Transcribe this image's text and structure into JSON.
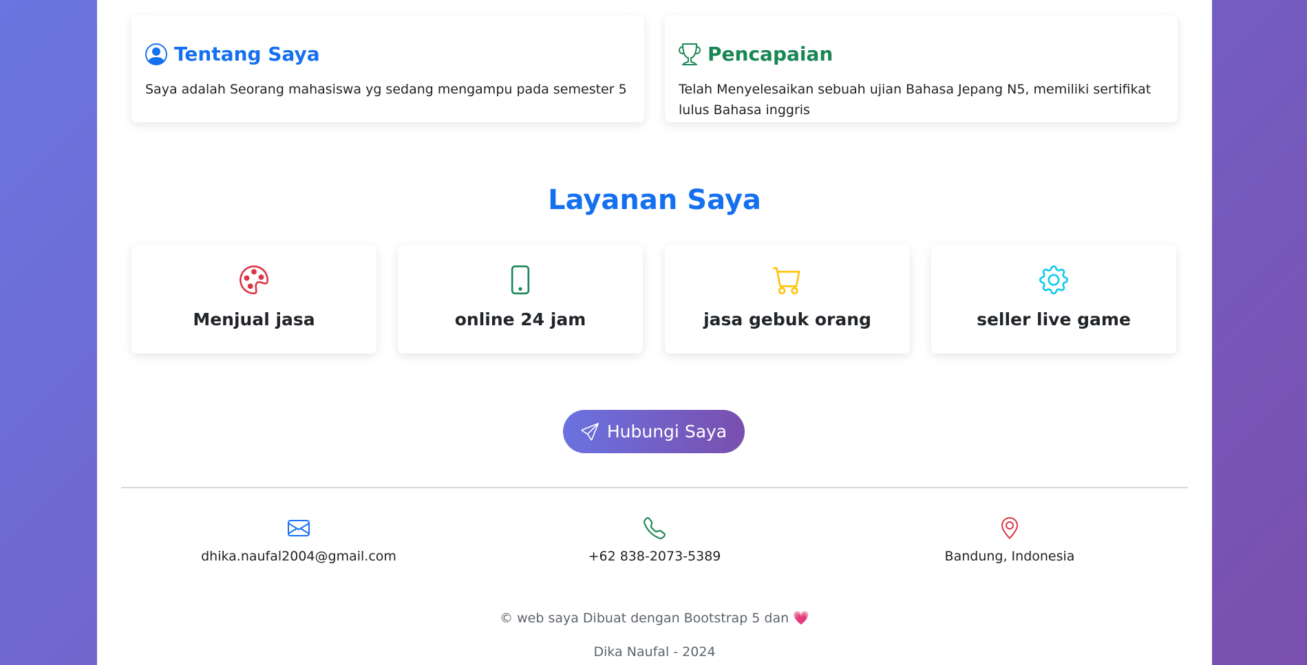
{
  "about": {
    "title": "Tentang Saya",
    "text": "Saya adalah Seorang mahasiswa yg sedang mengampu pada semester 5",
    "icon": "person-circle-icon",
    "color": "#1570ef"
  },
  "achievement": {
    "title": "Pencapaian",
    "text": "Telah Menyelesaikan sebuah ujian Bahasa Jepang N5, memiliki sertifikat lulus Bahasa inggris",
    "icon": "trophy-icon",
    "color": "#198754"
  },
  "services": {
    "title": "Layanan Saya",
    "items": [
      {
        "label": "Menjual jasa",
        "icon": "palette-icon",
        "color": "#dc3545"
      },
      {
        "label": "online 24 jam",
        "icon": "phone-icon",
        "color": "#198754"
      },
      {
        "label": "jasa gebuk orang",
        "icon": "cart-icon",
        "color": "#ffc107"
      },
      {
        "label": "seller live game",
        "icon": "gear-icon",
        "color": "#0dcaf0"
      }
    ]
  },
  "cta": {
    "label": "Hubungi Saya",
    "icon": "send-icon"
  },
  "contacts": [
    {
      "text": "dhika.naufal2004@gmail.com",
      "icon": "envelope-icon",
      "color": "#1570ef"
    },
    {
      "text": "+62 838-2073-5389",
      "icon": "telephone-icon",
      "color": "#198754"
    },
    {
      "text": "Bandung, Indonesia",
      "icon": "geo-pin-icon",
      "color": "#dc3545"
    }
  ],
  "footer": {
    "copyright": "© web saya Dibuat dengan Bootstrap 5 dan",
    "heart": "💗",
    "author": "Dika Naufal - 2024"
  }
}
